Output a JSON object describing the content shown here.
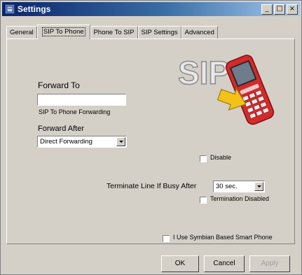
{
  "window": {
    "title": "Settings",
    "minimize": "_",
    "maximize": "□",
    "close": "×"
  },
  "tabs": [
    "General",
    "SIP To Phone",
    "Phone To SIP",
    "SIP Settings",
    "Advanced"
  ],
  "active_tab": "SIP To Phone",
  "forward_to": {
    "label": "Forward To",
    "value": "",
    "caption": "SIP To Phone Forwarding"
  },
  "forward_after": {
    "label": "Forward After",
    "selected": "Direct Forwarding"
  },
  "logo": {
    "text": "SIP"
  },
  "disable": {
    "label": "Disable",
    "checked": false
  },
  "terminate": {
    "label": "Terminate Line If Busy After",
    "selected": "30 sec."
  },
  "termination_disabled": {
    "label": "Termination Disabled",
    "checked": false
  },
  "symbian": {
    "label": "I Use Symbian Based Smart Phone",
    "checked": false
  },
  "buttons": {
    "ok": "OK",
    "cancel": "Cancel",
    "apply": "Apply"
  },
  "colors": {
    "titlebar_start": "#0a246a",
    "face": "#d4d0c8",
    "phone_red": "#d42a2a",
    "arrow_yellow": "#f2c21a"
  }
}
